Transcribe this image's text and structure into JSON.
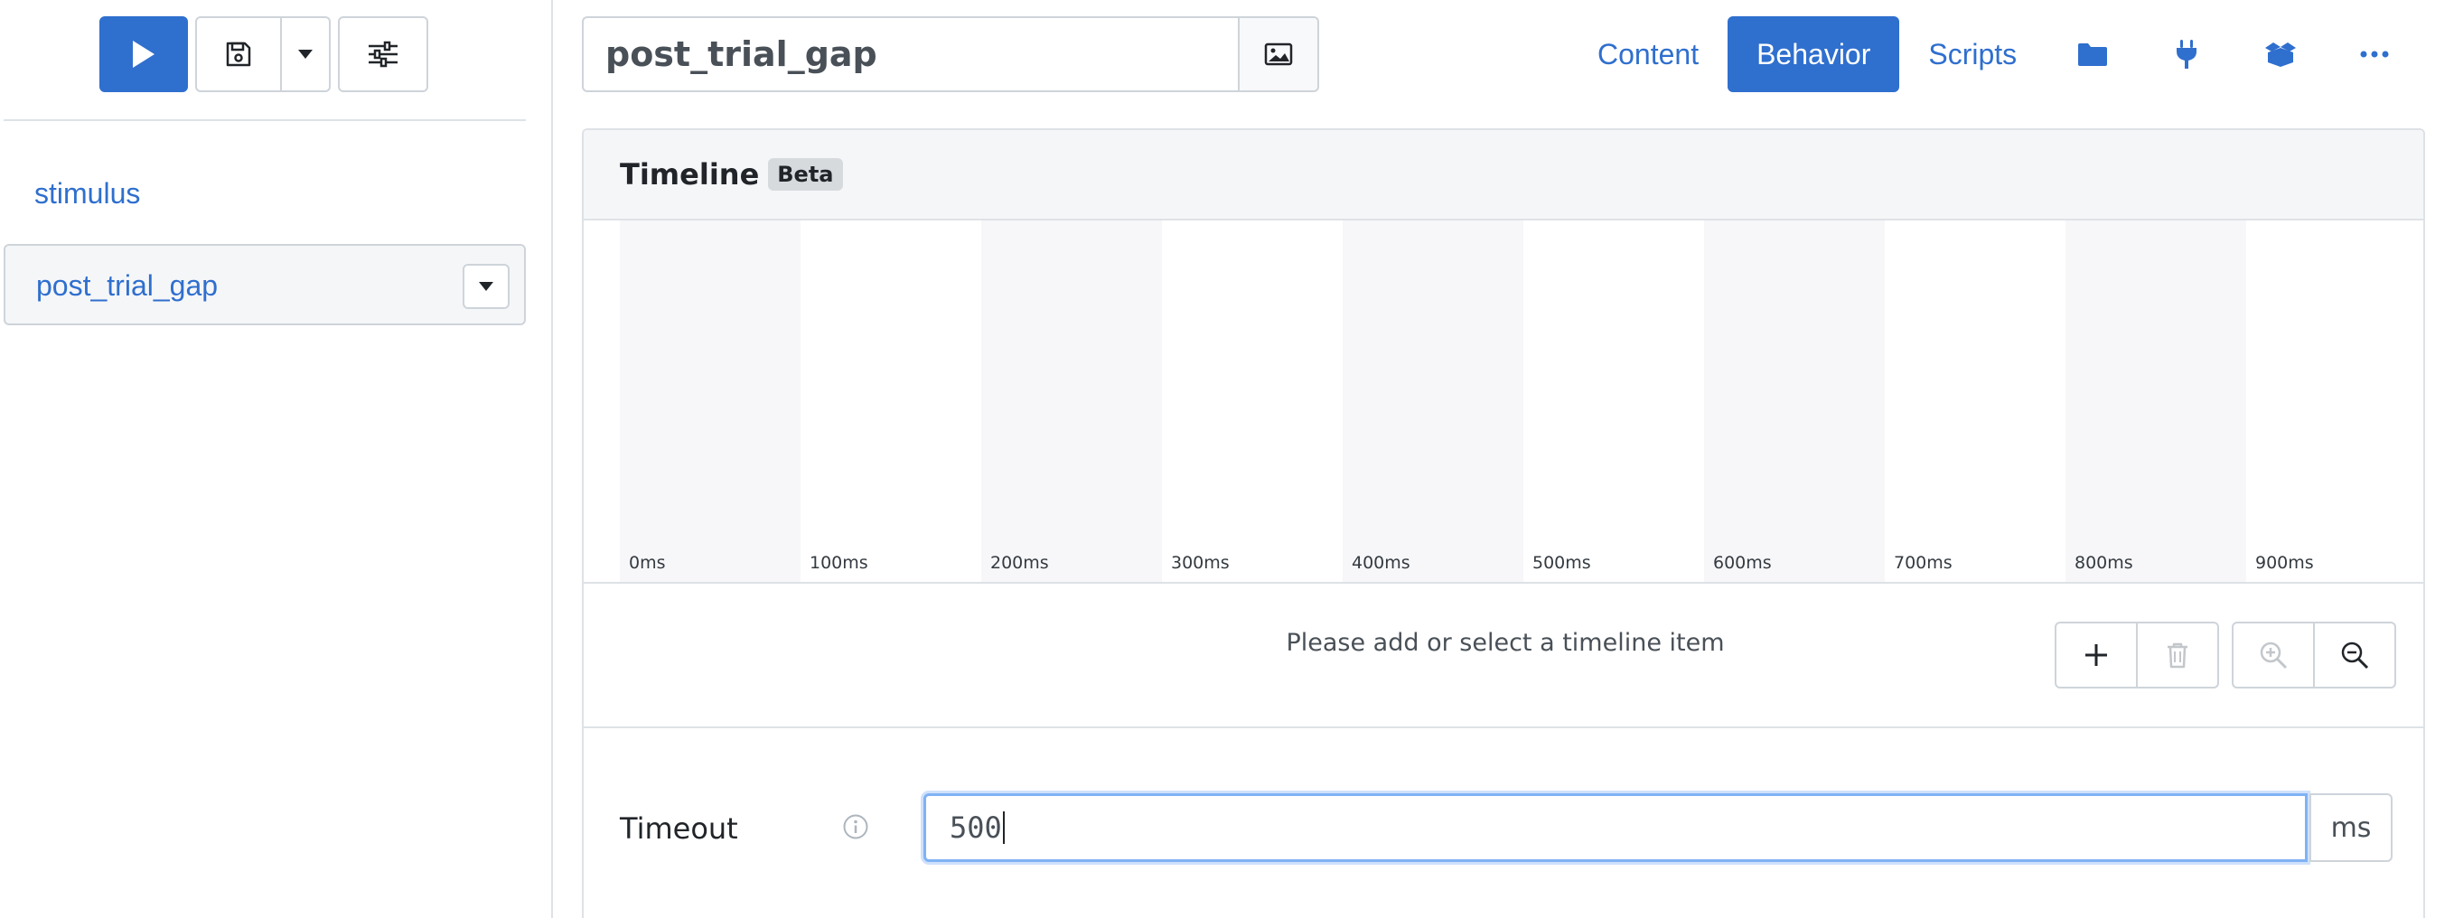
{
  "sidebar": {
    "toolbar": {
      "run_icon": "play-icon",
      "save_icon": "floppy-disk-icon",
      "save_menu_icon": "caret-down-icon",
      "settings_icon": "sliders-icon"
    },
    "items": [
      {
        "label": "stimulus"
      },
      {
        "label": "post_trial_gap"
      }
    ]
  },
  "header": {
    "title_value": "post_trial_gap",
    "title_image_icon": "image-icon",
    "tabs": [
      {
        "label": "Content",
        "active": false
      },
      {
        "label": "Behavior",
        "active": true
      },
      {
        "label": "Scripts",
        "active": false
      }
    ],
    "icons": [
      "folder-icon",
      "plug-icon",
      "box-open-icon",
      "ellipsis-icon"
    ]
  },
  "timeline": {
    "title": "Timeline",
    "badge": "Beta",
    "ticks": [
      "0ms",
      "100ms",
      "200ms",
      "300ms",
      "400ms",
      "500ms",
      "600ms",
      "700ms",
      "800ms",
      "900ms"
    ],
    "empty_message": "Please add or select a timeline item",
    "controls": {
      "add_icon": "plus-icon",
      "delete_icon": "trash-icon",
      "zoom_in_icon": "zoom-in-icon",
      "zoom_out_icon": "zoom-out-icon"
    }
  },
  "timeout": {
    "label": "Timeout",
    "value": "500",
    "unit": "ms"
  },
  "colors": {
    "accent": "#2f6fce",
    "border": "#ced4da",
    "panel_bg": "#f5f6f8"
  }
}
